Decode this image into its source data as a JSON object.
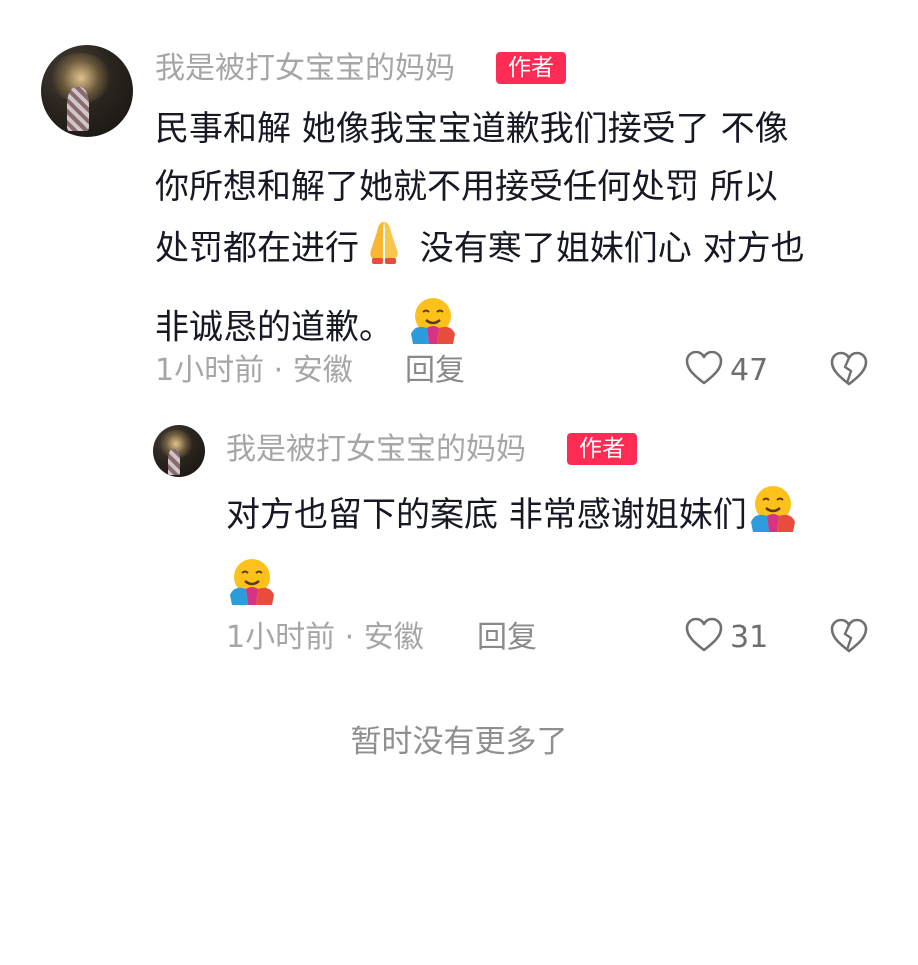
{
  "comments": [
    {
      "username": "我是被打女宝宝的妈妈",
      "badge": "作者",
      "text_lines": [
        "民事和解 她像我宝宝道歉我们接受了 不像",
        "你所想和解了她就不用接受任何处罚 所以",
        "处罚都在进行",
        " 没有寒了姐妹们心 对方也",
        "非诚恳的道歉。"
      ],
      "emojis": [
        "folded-hands",
        "hugging-face"
      ],
      "time": "1小时前 · 安徽",
      "reply_label": "回复",
      "likes": "47"
    },
    {
      "username": "我是被打女宝宝的妈妈",
      "badge": "作者",
      "text_lines": [
        "对方也留下的案底 非常感谢姐妹们"
      ],
      "emojis": [
        "hugging-face",
        "hugging-face"
      ],
      "time": "1小时前 · 安徽",
      "reply_label": "回复",
      "likes": "31"
    }
  ],
  "footer": {
    "no_more": "暂时没有更多了"
  },
  "colors": {
    "badge": "#fe2c55",
    "text": "#161823",
    "meta": "#a6a6a6"
  }
}
